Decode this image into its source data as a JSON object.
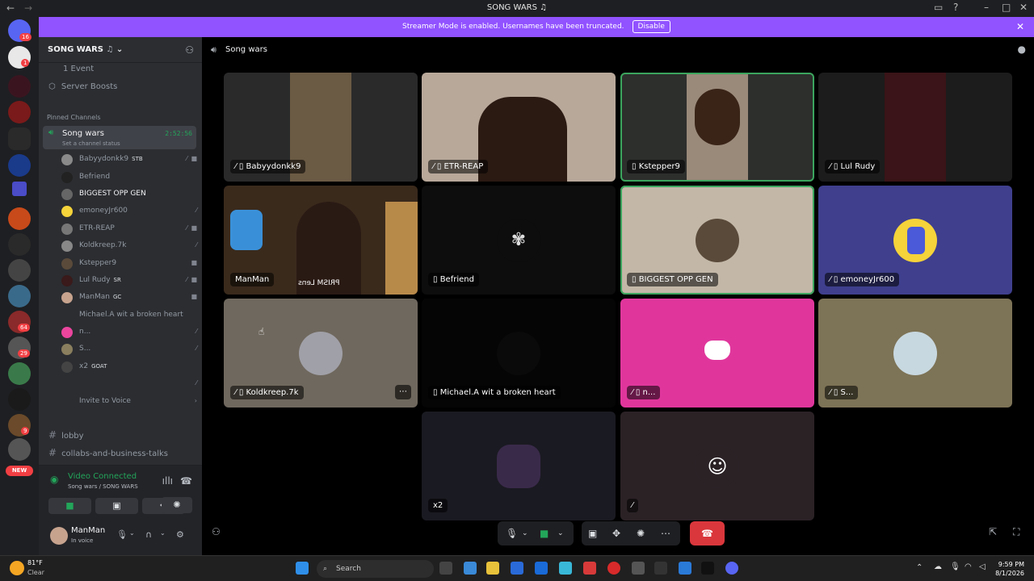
{
  "window": {
    "title": "SONG WARS",
    "title_icon": "music-note",
    "back": "←",
    "forward": "→"
  },
  "banner": {
    "text": "Streamer Mode is enabled. Usernames have been truncated.",
    "button": "Disable"
  },
  "guilds": {
    "badges": [
      "16",
      "1",
      "64",
      "29",
      "9"
    ],
    "new_label": "NEW"
  },
  "server": {
    "name": "SONG WARS",
    "events": "1 Event",
    "boosts": "Server Boosts",
    "pinned_header": "Pinned Channels"
  },
  "voice_channel": {
    "name": "Song wars",
    "timer": "2:52:56",
    "status": "Set a channel status"
  },
  "members": [
    {
      "name": "Babyydonkk9",
      "tag": "STB",
      "color": "#8a8a8a"
    },
    {
      "name": "Befriend",
      "tag": "",
      "color": "#222"
    },
    {
      "name": "BIGGEST OPP GEN",
      "tag": "",
      "color": "#666"
    },
    {
      "name": "emoneyJr600",
      "tag": "",
      "color": "#f5d33a"
    },
    {
      "name": "ETR-REAP",
      "tag": "",
      "color": "#777"
    },
    {
      "name": "Koldkreep.7k",
      "tag": "",
      "color": "#888"
    },
    {
      "name": "Kstepper9",
      "tag": "",
      "color": "#5a4a3a"
    },
    {
      "name": "Lul Rudy",
      "tag": "SR",
      "color": "#3a1a1a"
    },
    {
      "name": "ManMan",
      "tag": "GC",
      "color": "#c7a38e"
    },
    {
      "name": "Michael.A wit a broken heart",
      "tag": "",
      "color": "#2b2d31"
    },
    {
      "name": "n...",
      "tag": "",
      "color": "#eb459e"
    },
    {
      "name": "S...",
      "tag": "",
      "color": "#8a7f5e"
    },
    {
      "name": "x2",
      "tag": "GOAT",
      "color": "#444"
    },
    {
      "name": "",
      "tag": "",
      "color": "#2b2d31"
    }
  ],
  "invite": "Invite to Voice",
  "text_channels": [
    "lobby",
    "collabs-and-business-talks"
  ],
  "voice_connected": {
    "title": "Video Connected",
    "subtitle": "Song wars / SONG WARS"
  },
  "user": {
    "name": "ManMan",
    "status": "In voice"
  },
  "main": {
    "channel": "Song wars"
  },
  "tiles": [
    {
      "label": "Babyydonkk9",
      "bg": "#2a2a2a"
    },
    {
      "label": "ETR-REAP",
      "bg": "#b8a89a"
    },
    {
      "label": "Kstepper9",
      "bg": "#2d2f2d"
    },
    {
      "label": "Lul Rudy",
      "bg": "#1c1c1c"
    },
    {
      "label": "ManMan",
      "bg": "#3a2a1c",
      "overlay": "PRISM Lens"
    },
    {
      "label": "Befriend",
      "bg": "#0d0d0d"
    },
    {
      "label": "BIGGEST OPP GEN",
      "bg": "#c3b8a8"
    },
    {
      "label": "emoneyJr600",
      "bg": "#3f3f8e"
    },
    {
      "label": "Koldkreep.7k",
      "bg": "#6f685e"
    },
    {
      "label": "Michael.A wit a broken heart",
      "bg": "#050505"
    },
    {
      "label": "n...",
      "bg": "#e0369c"
    },
    {
      "label": "S...",
      "bg": "#7d7356"
    },
    {
      "label": "x2",
      "bg": "#1a1a22"
    },
    {
      "label": "",
      "bg": "#2b2226"
    }
  ],
  "taskbar": {
    "temp": "81°F",
    "weather": "Clear",
    "search": "Search",
    "time": "9:59 PM",
    "date": "8/1/2026"
  }
}
